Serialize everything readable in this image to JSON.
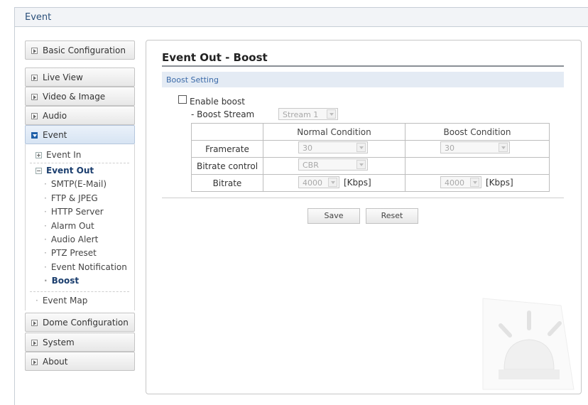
{
  "header": {
    "title": "Event"
  },
  "sidebar": {
    "items": [
      {
        "label": "Basic Configuration"
      },
      {
        "label": "Live View"
      },
      {
        "label": "Video & Image"
      },
      {
        "label": "Audio"
      },
      {
        "label": "Event"
      },
      {
        "label": "Dome Configuration"
      },
      {
        "label": "System"
      },
      {
        "label": "About"
      }
    ],
    "event_tree": {
      "event_in": "Event In",
      "event_out": "Event Out",
      "children": [
        "SMTP(E-Mail)",
        "FTP & JPEG",
        "HTTP Server",
        "Alarm Out",
        "Audio Alert",
        "PTZ Preset",
        "Event Notification",
        "Boost"
      ],
      "event_map": "Event Map"
    }
  },
  "main": {
    "title": "Event Out - Boost",
    "section": "Boost Setting",
    "enable_label": "Enable boost",
    "stream_label": "- Boost Stream",
    "stream_value": "Stream 1",
    "table": {
      "col_normal": "Normal Condition",
      "col_boost": "Boost Condition",
      "row_framerate": "Framerate",
      "row_bitrate_control": "Bitrate control",
      "row_bitrate": "Bitrate",
      "normal_framerate": "30",
      "boost_framerate": "30",
      "normal_bitrate_control": "CBR",
      "normal_bitrate": "4000",
      "boost_bitrate": "4000",
      "unit": "[Kbps]"
    },
    "save_label": "Save",
    "reset_label": "Reset"
  },
  "colors": {
    "accent": "#1f5fa8",
    "section_bg": "#e4ebf4",
    "section_text": "#3b6aa8"
  }
}
